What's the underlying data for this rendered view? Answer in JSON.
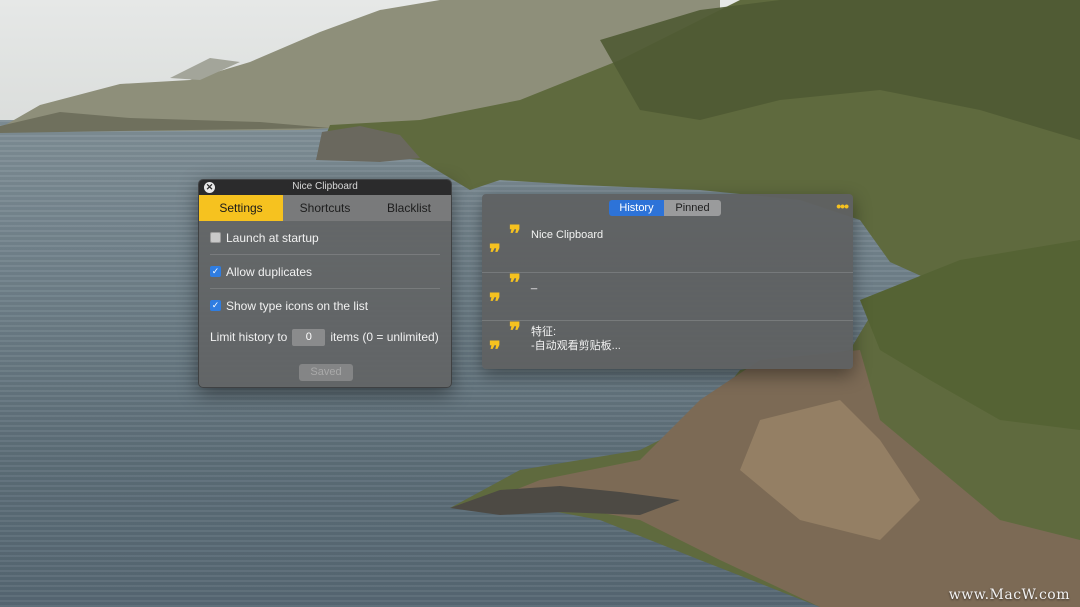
{
  "settings_window": {
    "title": "Nice Clipboard",
    "tabs": [
      "Settings",
      "Shortcuts",
      "Blacklist"
    ],
    "active_tab": "Settings",
    "options": [
      {
        "label": "Launch at startup",
        "checked": false
      },
      {
        "label": "Allow duplicates",
        "checked": true
      },
      {
        "label": "Show type icons on the list",
        "checked": true
      }
    ],
    "limit": {
      "prefix": "Limit history to",
      "value": "0",
      "suffix": "items (0 = unlimited)"
    },
    "saved_label": "Saved"
  },
  "history_window": {
    "segments": [
      "History",
      "Pinned"
    ],
    "active_segment": "History",
    "more_icon": "ellipsis-icon",
    "entries": [
      {
        "line1": "Nice Clipboard",
        "line2": ""
      },
      {
        "line1": "_",
        "line2": ""
      },
      {
        "line1": "特征:",
        "line2": "-自动观看剪贴板..."
      }
    ]
  },
  "watermark": "www.MacW.com",
  "colors": {
    "accent_yellow": "#f6c21f",
    "selected_blue": "#2d73d8",
    "panel_bg": "#626465"
  }
}
